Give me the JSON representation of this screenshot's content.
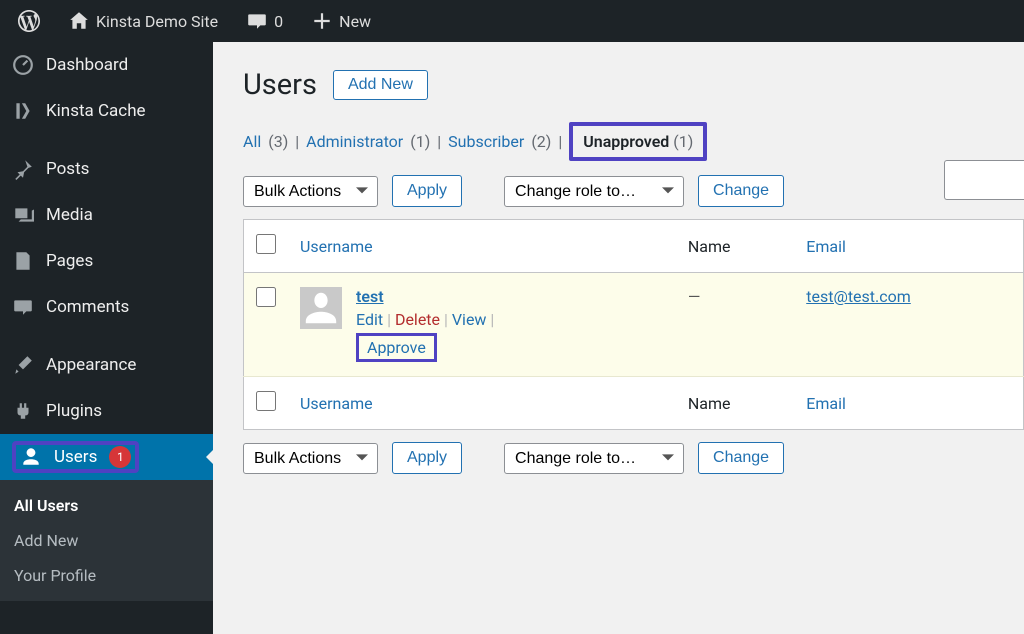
{
  "adminbar": {
    "site_name": "Kinsta Demo Site",
    "comment_count": "0",
    "new_label": "New"
  },
  "sidebar": {
    "items": [
      {
        "label": "Dashboard"
      },
      {
        "label": "Kinsta Cache"
      },
      {
        "label": "Posts"
      },
      {
        "label": "Media"
      },
      {
        "label": "Pages"
      },
      {
        "label": "Comments"
      },
      {
        "label": "Appearance"
      },
      {
        "label": "Plugins"
      },
      {
        "label": "Users",
        "badge": "1"
      }
    ],
    "submenu": [
      "All Users",
      "Add New",
      "Your Profile"
    ]
  },
  "page": {
    "title": "Users",
    "add_new": "Add New"
  },
  "filters": {
    "all_label": "All",
    "all_count": "(3)",
    "admin_label": "Administrator",
    "admin_count": "(1)",
    "sub_label": "Subscriber",
    "sub_count": "(2)",
    "unapproved_label": "Unapproved",
    "unapproved_count": "(1)"
  },
  "actions": {
    "bulk": "Bulk Actions",
    "apply": "Apply",
    "change_role": "Change role to…",
    "change": "Change"
  },
  "table": {
    "col_username": "Username",
    "col_name": "Name",
    "col_email": "Email",
    "row": {
      "username": "test",
      "name": "—",
      "email": "test@test.com",
      "actions": {
        "edit": "Edit",
        "delete": "Delete",
        "view": "View",
        "approve": "Approve"
      }
    }
  }
}
